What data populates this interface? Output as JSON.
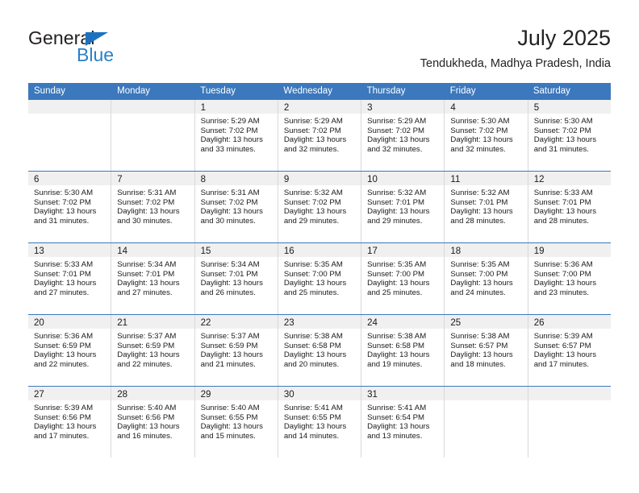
{
  "brand": {
    "name_dark": "General",
    "name_blue": "Blue",
    "triangle_color": "#1c72bf",
    "blue_color": "#2980c8"
  },
  "header": {
    "title": "July 2025",
    "subtitle": "Tendukheda, Madhya Pradesh, India"
  },
  "theme": {
    "header_blue": "#3b78bd",
    "daystrip_gray": "#f0f0f0",
    "divider_gray": "#d9d9d9"
  },
  "weekdays": [
    "Sunday",
    "Monday",
    "Tuesday",
    "Wednesday",
    "Thursday",
    "Friday",
    "Saturday"
  ],
  "weeks": [
    [
      {
        "day": "",
        "empty": true
      },
      {
        "day": "",
        "empty": true
      },
      {
        "day": "1",
        "sunrise": "Sunrise: 5:29 AM",
        "sunset": "Sunset: 7:02 PM",
        "daylight": "Daylight: 13 hours and 33 minutes."
      },
      {
        "day": "2",
        "sunrise": "Sunrise: 5:29 AM",
        "sunset": "Sunset: 7:02 PM",
        "daylight": "Daylight: 13 hours and 32 minutes."
      },
      {
        "day": "3",
        "sunrise": "Sunrise: 5:29 AM",
        "sunset": "Sunset: 7:02 PM",
        "daylight": "Daylight: 13 hours and 32 minutes."
      },
      {
        "day": "4",
        "sunrise": "Sunrise: 5:30 AM",
        "sunset": "Sunset: 7:02 PM",
        "daylight": "Daylight: 13 hours and 32 minutes."
      },
      {
        "day": "5",
        "sunrise": "Sunrise: 5:30 AM",
        "sunset": "Sunset: 7:02 PM",
        "daylight": "Daylight: 13 hours and 31 minutes."
      }
    ],
    [
      {
        "day": "6",
        "sunrise": "Sunrise: 5:30 AM",
        "sunset": "Sunset: 7:02 PM",
        "daylight": "Daylight: 13 hours and 31 minutes."
      },
      {
        "day": "7",
        "sunrise": "Sunrise: 5:31 AM",
        "sunset": "Sunset: 7:02 PM",
        "daylight": "Daylight: 13 hours and 30 minutes."
      },
      {
        "day": "8",
        "sunrise": "Sunrise: 5:31 AM",
        "sunset": "Sunset: 7:02 PM",
        "daylight": "Daylight: 13 hours and 30 minutes."
      },
      {
        "day": "9",
        "sunrise": "Sunrise: 5:32 AM",
        "sunset": "Sunset: 7:02 PM",
        "daylight": "Daylight: 13 hours and 29 minutes."
      },
      {
        "day": "10",
        "sunrise": "Sunrise: 5:32 AM",
        "sunset": "Sunset: 7:01 PM",
        "daylight": "Daylight: 13 hours and 29 minutes."
      },
      {
        "day": "11",
        "sunrise": "Sunrise: 5:32 AM",
        "sunset": "Sunset: 7:01 PM",
        "daylight": "Daylight: 13 hours and 28 minutes."
      },
      {
        "day": "12",
        "sunrise": "Sunrise: 5:33 AM",
        "sunset": "Sunset: 7:01 PM",
        "daylight": "Daylight: 13 hours and 28 minutes."
      }
    ],
    [
      {
        "day": "13",
        "sunrise": "Sunrise: 5:33 AM",
        "sunset": "Sunset: 7:01 PM",
        "daylight": "Daylight: 13 hours and 27 minutes."
      },
      {
        "day": "14",
        "sunrise": "Sunrise: 5:34 AM",
        "sunset": "Sunset: 7:01 PM",
        "daylight": "Daylight: 13 hours and 27 minutes."
      },
      {
        "day": "15",
        "sunrise": "Sunrise: 5:34 AM",
        "sunset": "Sunset: 7:01 PM",
        "daylight": "Daylight: 13 hours and 26 minutes."
      },
      {
        "day": "16",
        "sunrise": "Sunrise: 5:35 AM",
        "sunset": "Sunset: 7:00 PM",
        "daylight": "Daylight: 13 hours and 25 minutes."
      },
      {
        "day": "17",
        "sunrise": "Sunrise: 5:35 AM",
        "sunset": "Sunset: 7:00 PM",
        "daylight": "Daylight: 13 hours and 25 minutes."
      },
      {
        "day": "18",
        "sunrise": "Sunrise: 5:35 AM",
        "sunset": "Sunset: 7:00 PM",
        "daylight": "Daylight: 13 hours and 24 minutes."
      },
      {
        "day": "19",
        "sunrise": "Sunrise: 5:36 AM",
        "sunset": "Sunset: 7:00 PM",
        "daylight": "Daylight: 13 hours and 23 minutes."
      }
    ],
    [
      {
        "day": "20",
        "sunrise": "Sunrise: 5:36 AM",
        "sunset": "Sunset: 6:59 PM",
        "daylight": "Daylight: 13 hours and 22 minutes."
      },
      {
        "day": "21",
        "sunrise": "Sunrise: 5:37 AM",
        "sunset": "Sunset: 6:59 PM",
        "daylight": "Daylight: 13 hours and 22 minutes."
      },
      {
        "day": "22",
        "sunrise": "Sunrise: 5:37 AM",
        "sunset": "Sunset: 6:59 PM",
        "daylight": "Daylight: 13 hours and 21 minutes."
      },
      {
        "day": "23",
        "sunrise": "Sunrise: 5:38 AM",
        "sunset": "Sunset: 6:58 PM",
        "daylight": "Daylight: 13 hours and 20 minutes."
      },
      {
        "day": "24",
        "sunrise": "Sunrise: 5:38 AM",
        "sunset": "Sunset: 6:58 PM",
        "daylight": "Daylight: 13 hours and 19 minutes."
      },
      {
        "day": "25",
        "sunrise": "Sunrise: 5:38 AM",
        "sunset": "Sunset: 6:57 PM",
        "daylight": "Daylight: 13 hours and 18 minutes."
      },
      {
        "day": "26",
        "sunrise": "Sunrise: 5:39 AM",
        "sunset": "Sunset: 6:57 PM",
        "daylight": "Daylight: 13 hours and 17 minutes."
      }
    ],
    [
      {
        "day": "27",
        "sunrise": "Sunrise: 5:39 AM",
        "sunset": "Sunset: 6:56 PM",
        "daylight": "Daylight: 13 hours and 17 minutes."
      },
      {
        "day": "28",
        "sunrise": "Sunrise: 5:40 AM",
        "sunset": "Sunset: 6:56 PM",
        "daylight": "Daylight: 13 hours and 16 minutes."
      },
      {
        "day": "29",
        "sunrise": "Sunrise: 5:40 AM",
        "sunset": "Sunset: 6:55 PM",
        "daylight": "Daylight: 13 hours and 15 minutes."
      },
      {
        "day": "30",
        "sunrise": "Sunrise: 5:41 AM",
        "sunset": "Sunset: 6:55 PM",
        "daylight": "Daylight: 13 hours and 14 minutes."
      },
      {
        "day": "31",
        "sunrise": "Sunrise: 5:41 AM",
        "sunset": "Sunset: 6:54 PM",
        "daylight": "Daylight: 13 hours and 13 minutes."
      },
      {
        "day": "",
        "empty": true
      },
      {
        "day": "",
        "empty": true
      }
    ]
  ]
}
